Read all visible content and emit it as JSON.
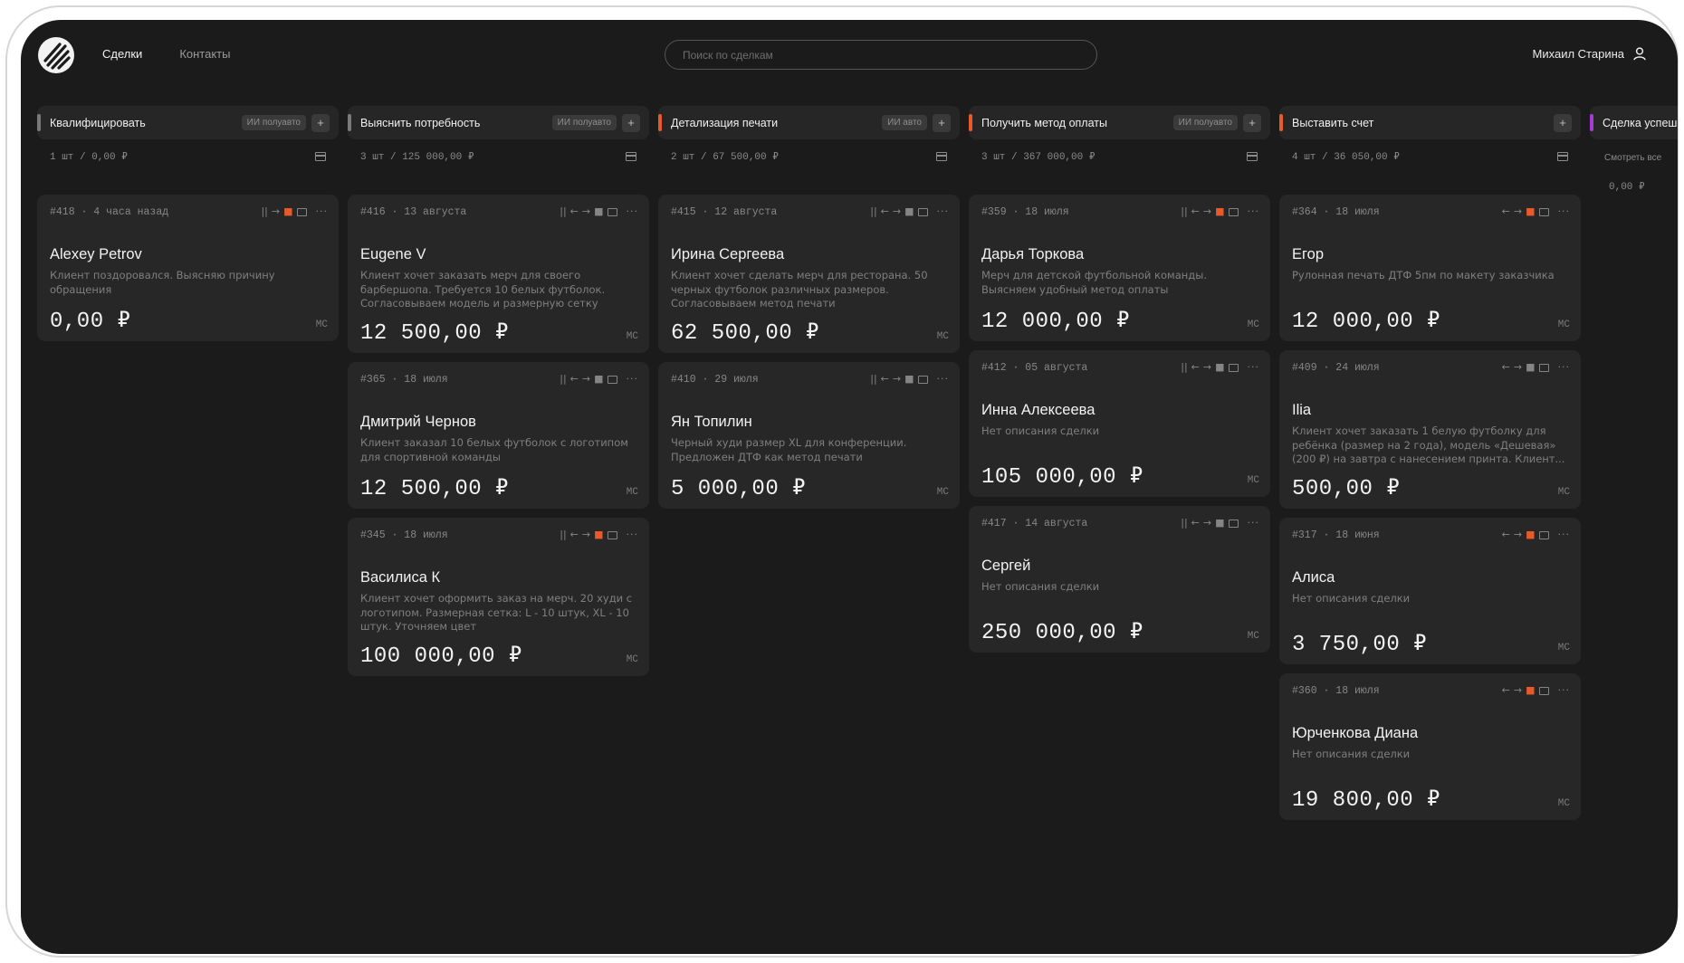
{
  "nav": {
    "deals": "Сделки",
    "contacts": "Контакты"
  },
  "search": {
    "placeholder": "Поиск по сделкам"
  },
  "user": {
    "name": "Михаил Старина"
  },
  "colors": {
    "gray": "#7a7a7a",
    "orange": "#e8592b",
    "purple": "#a63bd6"
  },
  "columns": [
    {
      "title": "Квалифицировать",
      "ai": "ИИ полуавто",
      "summary": "1 шт / 0,00 ₽"
    },
    {
      "title": "Выяснить потребность",
      "ai": "ИИ полуавто",
      "summary": "3 шт / 125 000,00 ₽"
    },
    {
      "title": "Детализация печати",
      "ai": "ИИ авто",
      "summary": "2 шт / 67 500,00 ₽"
    },
    {
      "title": "Получить метод оплаты",
      "ai": "ИИ полуавто",
      "summary": "3 шт / 367 000,00 ₽"
    },
    {
      "title": "Выставить счет",
      "ai": "",
      "summary": "4 шт / 36 050,00 ₽"
    },
    {
      "title": "Сделка успеш",
      "see_all": "Смотреть все",
      "summary": "0,00 ₽"
    }
  ],
  "cards": [
    {
      "meta": "#418 · 4 часа назад",
      "name": "Alexey Petrov",
      "desc": "Клиент поздоровался. Выясняю причину обращения",
      "price": "0,00 ₽",
      "tag": "МС"
    },
    {
      "meta": "#416 · 13 августа",
      "name": "Eugene V",
      "desc": "Клиент хочет заказать мерч для своего барбершопа. Требуется 10 белых футболок. Согласовываем модель и размерную сетку",
      "price": "12 500,00 ₽",
      "tag": "МС"
    },
    {
      "meta": "#365 · 18 июля",
      "name": "Дмитрий Чернов",
      "desc": "Клиент заказал 10 белых футболок с логотипом для спортивной команды",
      "price": "12 500,00 ₽",
      "tag": "МС"
    },
    {
      "meta": "#345 · 18 июля",
      "name": "Василиса К",
      "desc": "Клиент хочет оформить заказ на мерч. 20 худи с логотипом. Размерная сетка: L - 10 штук, XL - 10 штук. Уточняем цвет",
      "price": "100 000,00 ₽",
      "tag": "МС"
    },
    {
      "meta": "#415 · 12 августа",
      "name": "Ирина Сергеева",
      "desc": "Клиент хочет сделать мерч для ресторана. 50 черных футболок различных размеров. Согласовываем метод печати",
      "price": "62 500,00 ₽",
      "tag": "МС"
    },
    {
      "meta": "#410 · 29 июля",
      "name": "Ян Топилин",
      "desc": "Черный худи размер XL для конференции. Предложен ДТФ как метод печати",
      "price": "5 000,00 ₽",
      "tag": "МС"
    },
    {
      "meta": "#359 · 18 июля",
      "name": "Дарья Торкова",
      "desc": "Мерч для детской футбольной команды. Выясняем удобный метод оплаты",
      "price": "12 000,00 ₽",
      "tag": "МС"
    },
    {
      "meta": "#412 · 05 августа",
      "name": "Инна Алексеева",
      "desc": "Нет описания сделки",
      "price": "105 000,00 ₽",
      "tag": "МС"
    },
    {
      "meta": "#417 · 14 августа",
      "name": "Сергей",
      "desc": "Нет описания сделки",
      "price": "250 000,00 ₽",
      "tag": "МС"
    },
    {
      "meta": "#364 · 18 июля",
      "name": "Егор",
      "desc": "Рулонная печать ДТФ 5пм по макету заказчика",
      "price": "12 000,00 ₽",
      "tag": "МС"
    },
    {
      "meta": "#409 · 24 июля",
      "name": "Ilia",
      "desc": "Клиент хочет заказать 1 белую футболку для ребёнка (размер на 2 года), модель «Дешевая» (200 ₽) на завтра с нанесением принта. Клиент...",
      "price": "500,00 ₽",
      "tag": "МС"
    },
    {
      "meta": "#317 · 18 июня",
      "name": "Алиса",
      "desc": "Нет описания сделки",
      "price": "3 750,00 ₽",
      "tag": "МС"
    },
    {
      "meta": "#360 · 18 июля",
      "name": "Юрченкова Диана",
      "desc": "Нет описания сделки",
      "price": "19 800,00 ₽",
      "tag": "МС"
    }
  ]
}
